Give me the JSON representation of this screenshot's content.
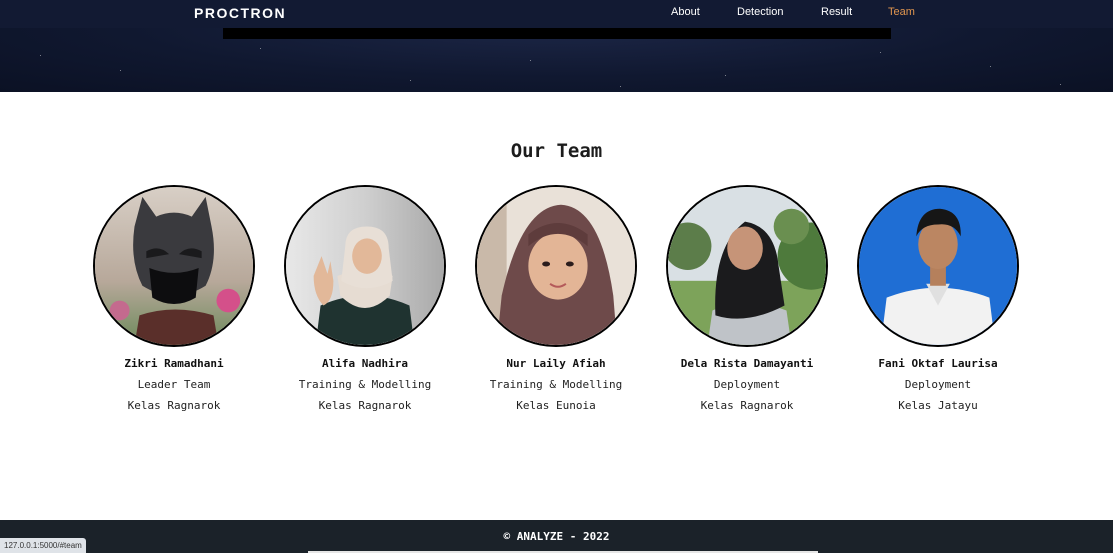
{
  "navbar": {
    "brand": "PROCTRON",
    "links": [
      {
        "label": "About"
      },
      {
        "label": "Detection"
      },
      {
        "label": "Result"
      },
      {
        "label": "Team"
      }
    ]
  },
  "team": {
    "title": "Our Team",
    "members": [
      {
        "name": "Zikri Ramadhani",
        "role": "Leader Team",
        "class": "Kelas Ragnarok"
      },
      {
        "name": "Alifa Nadhira",
        "role": "Training & Modelling",
        "class": "Kelas Ragnarok"
      },
      {
        "name": "Nur Laily Afiah",
        "role": "Training & Modelling",
        "class": "Kelas Eunoia"
      },
      {
        "name": "Dela Rista Damayanti",
        "role": "Deployment",
        "class": "Kelas Ragnarok"
      },
      {
        "name": "Fani Oktaf Laurisa",
        "role": "Deployment",
        "class": "Kelas Jatayu"
      }
    ]
  },
  "footer": {
    "text": "© ANALYZE - 2022"
  },
  "status_bar": {
    "url": "127.0.0.1:5000/#team"
  },
  "colors": {
    "nav_bg": "#121a33",
    "active_link": "#e0954f",
    "footer_bg": "#1b2229"
  }
}
